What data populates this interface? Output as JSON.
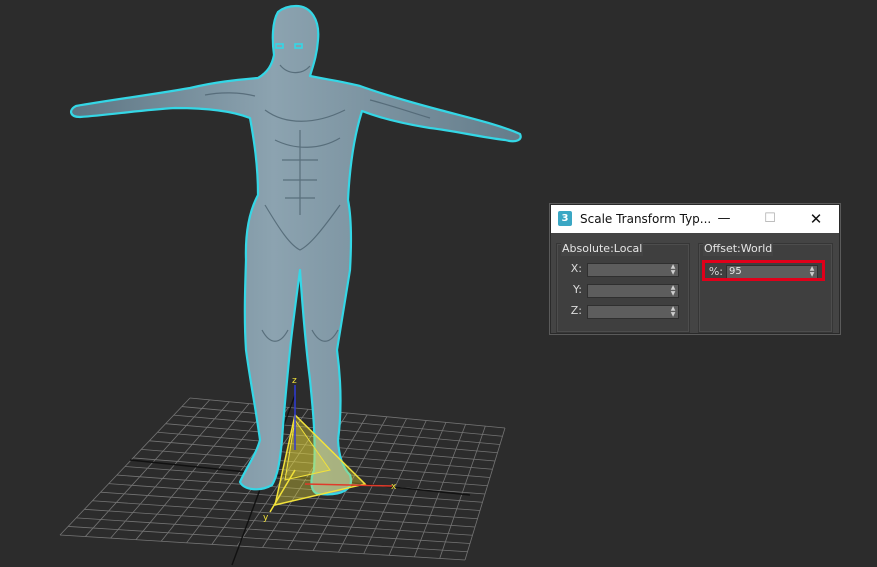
{
  "dialog": {
    "app_icon_glyph": "3",
    "title": "Scale Transform Typ...",
    "minimize_glyph": "—",
    "maximize_glyph": "☐",
    "close_glyph": "✕",
    "absolute_group": {
      "title": "Absolute:Local",
      "x_label": "X:",
      "x_value": "",
      "y_label": "Y:",
      "y_value": "",
      "z_label": "Z:",
      "z_value": ""
    },
    "offset_group": {
      "title": "Offset:World",
      "percent_label": "%:",
      "percent_value": "95"
    }
  },
  "viewport": {
    "gizmo_axis_x": "x",
    "gizmo_axis_y": "y",
    "gizmo_axis_z": "z"
  },
  "colors": {
    "viewport_bg": "#2c2c2c",
    "selection_outline": "#34d7e6",
    "model_skin": "#7d95a2",
    "grid": "#7a7a7a",
    "gizmo_yellow": "#f2e23a",
    "highlight_red": "#e0001a"
  }
}
